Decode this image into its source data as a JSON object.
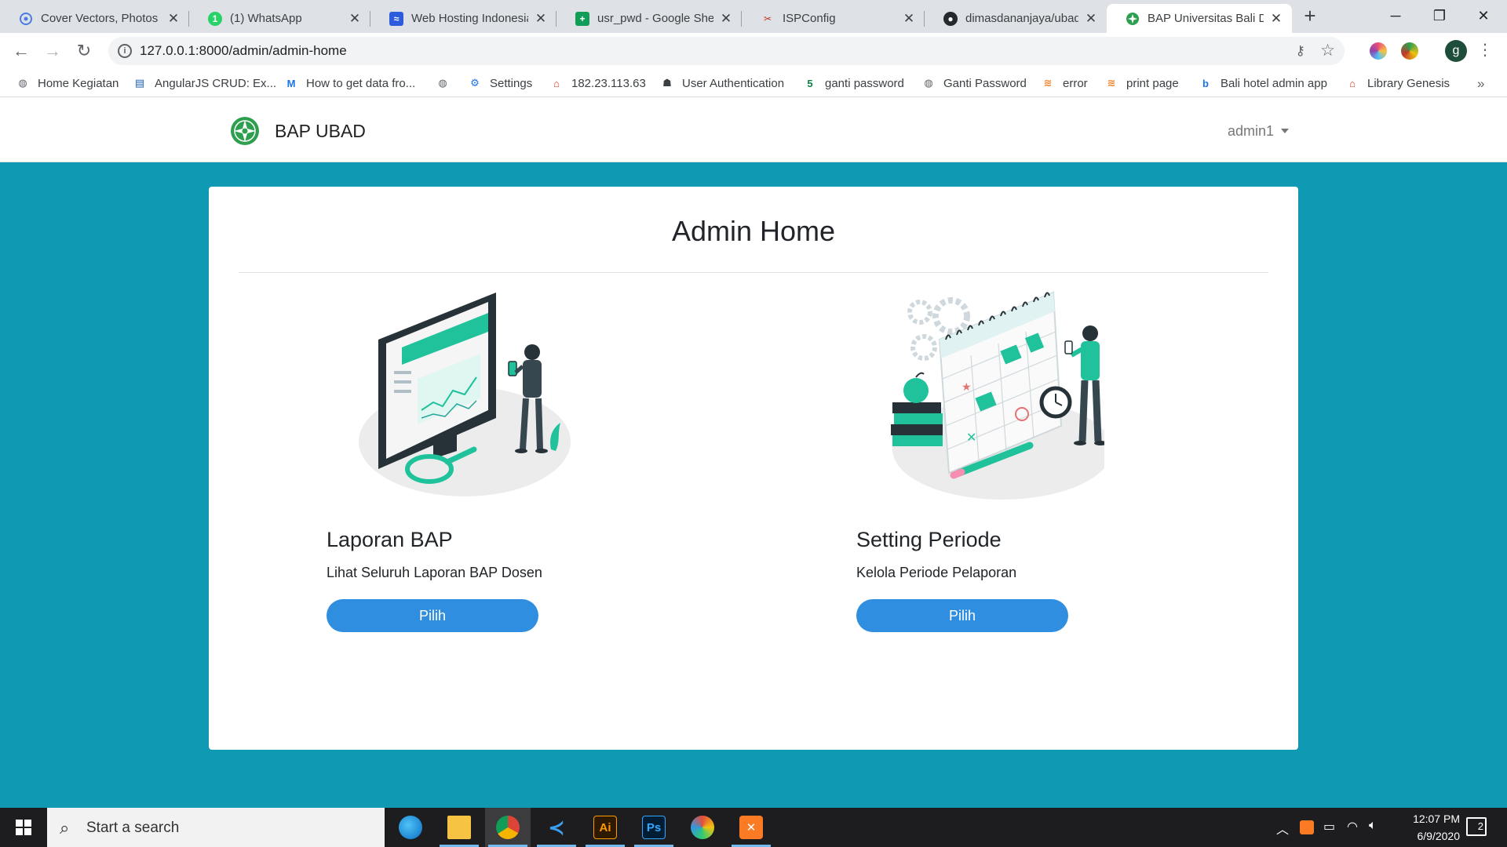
{
  "browser": {
    "tabs": [
      {
        "title": "Cover Vectors, Photos a",
        "icon": "stock-photo-icon",
        "color": "#4a7ce8"
      },
      {
        "title": "(1) WhatsApp",
        "icon": "whatsapp-icon",
        "color": "#25d366",
        "badge": "1"
      },
      {
        "title": "Web Hosting Indonesia",
        "icon": "hosting-icon",
        "color": "#2c5bdc"
      },
      {
        "title": "usr_pwd - Google Shee",
        "icon": "google-sheets-icon",
        "color": "#0f9d58"
      },
      {
        "title": "ISPConfig",
        "icon": "ispconfig-icon",
        "color": "#c0392b"
      },
      {
        "title": "dimasdananjaya/ubad-",
        "icon": "github-icon",
        "color": "#24292e"
      },
      {
        "title": "BAP Universitas Bali Dw",
        "icon": "ubad-logo-icon",
        "color": "#2e9e4f",
        "active": true
      }
    ],
    "new_tab": "+",
    "url": "127.0.0.1:8000/admin/admin-home",
    "bookmarks": [
      {
        "label": "Home Kegiatan",
        "icon": "globe-icon",
        "color": "#5f6368"
      },
      {
        "label": "AngularJS CRUD: Ex...",
        "icon": "document-icon",
        "color": "#1a5fb4"
      },
      {
        "label": "How to get data fro...",
        "icon": "medium-icon",
        "color": "#1a73e8"
      },
      {
        "label": "",
        "icon": "globe-icon",
        "color": "#5f6368"
      },
      {
        "label": "Settings",
        "icon": "gear-icon",
        "color": "#1a73e8"
      },
      {
        "label": "182.23.113.63",
        "icon": "router-icon",
        "color": "#d93025"
      },
      {
        "label": "User Authentication",
        "icon": "user-auth-icon",
        "color": "#3c4043"
      },
      {
        "label": "ganti password",
        "icon": "five-icon",
        "color": "#0b8043"
      },
      {
        "label": "Ganti Password",
        "icon": "globe-icon",
        "color": "#5f6368"
      },
      {
        "label": "error",
        "icon": "stackoverflow-icon",
        "color": "#f48024"
      },
      {
        "label": "print page",
        "icon": "stackoverflow-icon",
        "color": "#f48024"
      },
      {
        "label": "Bali hotel admin app",
        "icon": "b-icon",
        "color": "#1a73e8"
      },
      {
        "label": "Library Genesis",
        "icon": "library-icon",
        "color": "#d93025"
      }
    ],
    "bookmarks_more": "»",
    "profile_initial": "g"
  },
  "site": {
    "brand": "BAP UBAD",
    "user": "admin1",
    "page_title": "Admin Home",
    "menu": [
      {
        "title": "Laporan BAP",
        "description": "Lihat Seluruh Laporan BAP Dosen",
        "button": "Pilih",
        "illustration": "analytics-dashboard-illustration"
      },
      {
        "title": "Setting Periode",
        "description": "Kelola Periode Pelaporan",
        "button": "Pilih",
        "illustration": "calendar-planning-illustration"
      }
    ],
    "colors": {
      "background": "#0f99b3",
      "button": "#2f8ee0",
      "accent_green": "#1fc29a"
    }
  },
  "taskbar": {
    "search_placeholder": "Start a search",
    "apps": [
      "edge-icon",
      "file-explorer-icon",
      "chrome-icon",
      "vscode-icon",
      "illustrator-icon",
      "photoshop-icon",
      "paint-icon",
      "xampp-icon"
    ],
    "app_labels": {
      "illustrator": "Ai",
      "photoshop": "Ps"
    },
    "time": "12:07 PM",
    "date": "6/9/2020",
    "notifications": "2"
  }
}
